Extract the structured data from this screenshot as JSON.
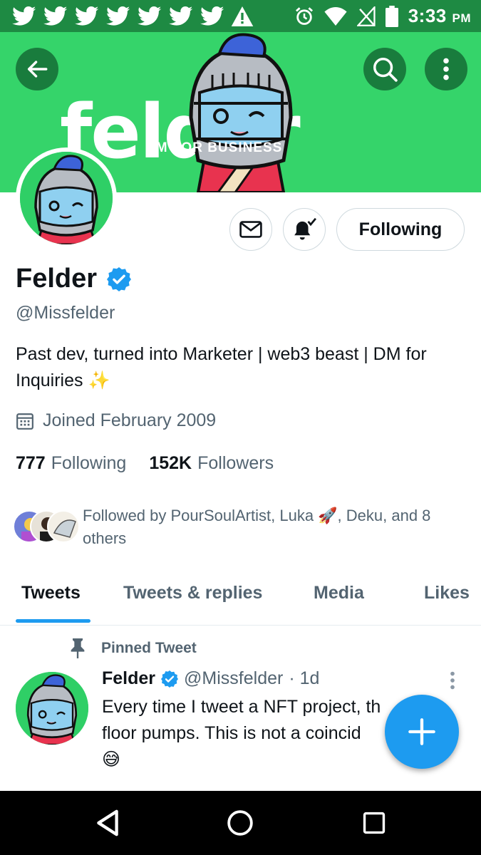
{
  "status_bar": {
    "time": "3:33",
    "ampm": "PM",
    "notification_icons": [
      "twitter-icon",
      "twitter-icon",
      "twitter-icon",
      "twitter-icon",
      "twitter-icon",
      "twitter-icon",
      "twitter-icon",
      "warning-icon"
    ],
    "system_icons": [
      "alarm-icon",
      "wifi-icon",
      "no-signal-icon",
      "battery-icon"
    ]
  },
  "banner": {
    "brand_text": "felder",
    "subtitle": "DM FOR BUSINESS",
    "background_color": "#35d46a"
  },
  "profile": {
    "name": "Felder",
    "handle": "@Missfelder",
    "bio": "Past dev, turned into Marketer | web3 beast | DM for Inquiries ✨",
    "joined": "Joined February 2009",
    "following_count": "777",
    "following_label": "Following",
    "followers_count": "152K",
    "followers_label": "Followers",
    "followed_by": "Followed by PourSoulArtist, Luka 🚀, Deku, and 8 others",
    "follow_button_label": "Following",
    "verified": true
  },
  "tabs": [
    {
      "label": "Tweets",
      "active": true
    },
    {
      "label": "Tweets & replies",
      "active": false
    },
    {
      "label": "Media",
      "active": false
    },
    {
      "label": "Likes",
      "active": false
    }
  ],
  "pinned_tweet": {
    "pinned_label": "Pinned Tweet",
    "author": "Felder",
    "handle": "@Missfelder",
    "time": "· 1d",
    "line1": "Every time I tweet a NFT project, th",
    "line2": "floor pumps. This is not a coincid",
    "line3": "😅"
  },
  "colors": {
    "accent": "#1d9bf0",
    "status_bar": "#1e8a43",
    "secondary_text": "#536471"
  }
}
